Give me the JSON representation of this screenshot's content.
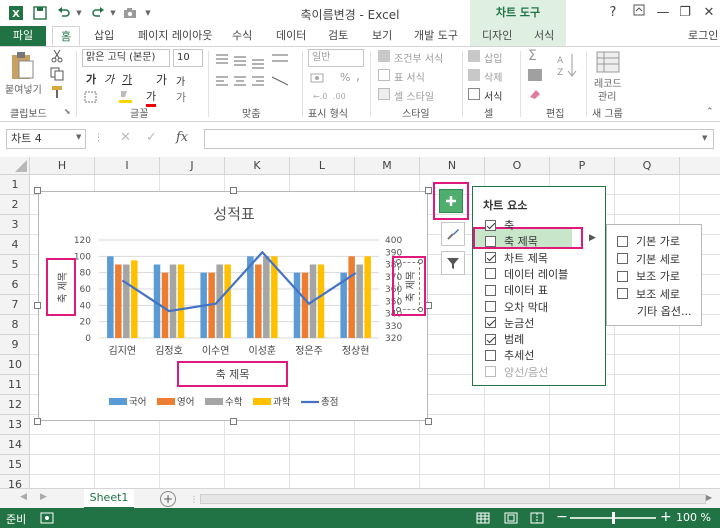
{
  "titlebar": {
    "title": "축이름변경 - Excel",
    "chart_tools": "차트 도구",
    "help": "?",
    "minimize": "—",
    "restore": "❐",
    "close": "✕",
    "login": "로그인"
  },
  "tabs": {
    "file": "파일",
    "home": "홈",
    "insert": "삽입",
    "page_layout": "페이지 레이아웃",
    "formulas": "수식",
    "data": "데이터",
    "review": "검토",
    "view": "보기",
    "developer": "개발 도구",
    "design": "디자인",
    "format": "서식"
  },
  "ribbon": {
    "clipboard": {
      "paste": "붙여넣기",
      "label": "클립보드"
    },
    "font": {
      "name": "맑은 고딕 (본문)",
      "size": "10",
      "bold": "가",
      "italic": "가",
      "underline": "가",
      "grow": "가",
      "shrink": "가",
      "fill_glyph": "가",
      "ruby": "가",
      "label": "글꼴"
    },
    "alignment": {
      "label": "맞춤"
    },
    "number": {
      "format": "일반",
      "percent": "%",
      "comma": ",",
      "label": "표시 형식"
    },
    "styles": {
      "conditional": "조건부 서식",
      "table": "표 서식",
      "cell": "셀 스타일",
      "label": "스타일"
    },
    "cells": {
      "insert": "삽입",
      "delete": "삭제",
      "format": "서식",
      "label": "셀"
    },
    "editing": {
      "sum": "Σ",
      "label": "편집"
    },
    "new_group": {
      "record": "레코드",
      "manage": "관리",
      "label": "새 그룹"
    }
  },
  "formula_bar": {
    "name_box": "차트 4",
    "fx": "fx",
    "cancel": "✕",
    "enter": "✓"
  },
  "columns": [
    "H",
    "I",
    "J",
    "K",
    "L",
    "M",
    "N",
    "O",
    "P",
    "Q"
  ],
  "rows": [
    "1",
    "2",
    "3",
    "4",
    "5",
    "6",
    "7",
    "8",
    "9",
    "10",
    "11",
    "12",
    "13",
    "14",
    "15",
    "16"
  ],
  "chart_data": {
    "type": "bar",
    "title": "성적표",
    "categories": [
      "김지연",
      "김정호",
      "이수연",
      "이성훈",
      "정은주",
      "정상현"
    ],
    "series": [
      {
        "name": "국어",
        "values": [
          100,
          90,
          80,
          100,
          80,
          80
        ],
        "color": "#5b9bd5"
      },
      {
        "name": "영어",
        "values": [
          90,
          80,
          80,
          90,
          80,
          100
        ],
        "color": "#ed7d31"
      },
      {
        "name": "수학",
        "values": [
          90,
          90,
          90,
          100,
          90,
          90
        ],
        "color": "#a5a5a5"
      },
      {
        "name": "과학",
        "values": [
          95,
          90,
          90,
          100,
          90,
          100
        ],
        "color": "#ffc000"
      },
      {
        "name": "총점",
        "type": "line",
        "axis": "secondary",
        "values": [
          367,
          342,
          348,
          390,
          348,
          373
        ],
        "color": "#4472c4"
      }
    ],
    "y_ticks": [
      "0",
      "20",
      "40",
      "60",
      "80",
      "100",
      "120"
    ],
    "y2_ticks": [
      "320",
      "330",
      "340",
      "350",
      "360",
      "370",
      "380",
      "390",
      "400"
    ],
    "ylim": [
      0,
      120
    ],
    "y2lim": [
      320,
      400
    ],
    "axis_title_placeholder_x": "축 제목",
    "axis_title_vertical": "축 제목",
    "legend_position": "bottom",
    "grid": true
  },
  "chart_elements": {
    "header": "차트 요소",
    "items": [
      {
        "label": "축",
        "checked": true
      },
      {
        "label": "축 제목",
        "checked": false
      },
      {
        "label": "차트 제목",
        "checked": true
      },
      {
        "label": "데이터 레이블",
        "checked": false
      },
      {
        "label": "데이터 표",
        "checked": false
      },
      {
        "label": "오차 막대",
        "checked": false
      },
      {
        "label": "눈금선",
        "checked": true
      },
      {
        "label": "범례",
        "checked": true
      },
      {
        "label": "추세선",
        "checked": false
      },
      {
        "label": "양선/음선",
        "checked": false
      }
    ],
    "submenu": {
      "items": [
        "기본 가로",
        "기본 세로",
        "보조 가로",
        "보조 세로"
      ],
      "more": "기타 옵션..."
    }
  },
  "sheet": {
    "name": "Sheet1",
    "add": "+"
  },
  "status": {
    "ready": "준비",
    "zoom": "100 %",
    "minus": "−",
    "plus": "+"
  },
  "colors": {
    "accent": "#217346",
    "highlight": "#e0197d"
  }
}
